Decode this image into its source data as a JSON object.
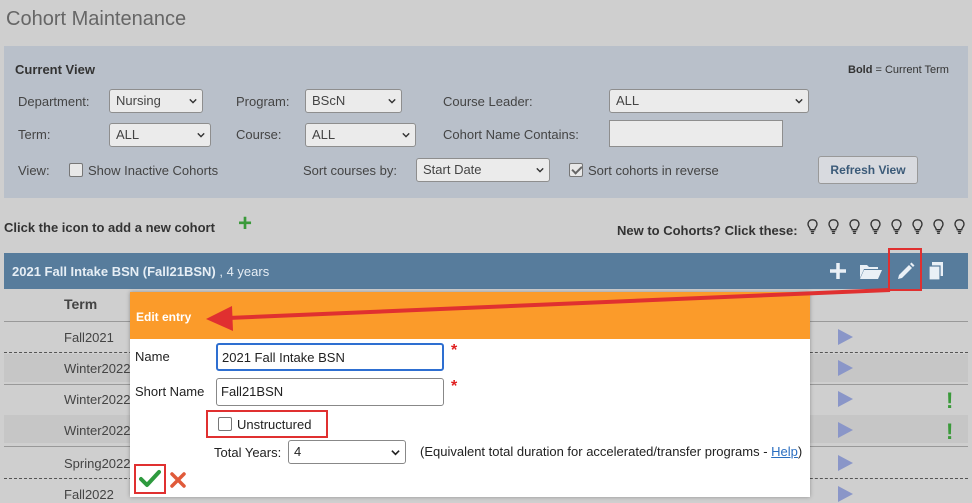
{
  "page": {
    "title": "Cohort Maintenance"
  },
  "current_view": {
    "title": "Current View",
    "bold_note_bold": "Bold",
    "bold_note_rest": " = Current Term",
    "department_label": "Department:",
    "department_value": "Nursing",
    "program_label": "Program:",
    "program_value": "BScN",
    "course_leader_label": "Course Leader:",
    "course_leader_value": "ALL",
    "term_label": "Term:",
    "term_value": "ALL",
    "course_label": "Course:",
    "course_value": "ALL",
    "cohort_name_label": "Cohort Name Contains:",
    "cohort_name_value": "",
    "view_label": "View:",
    "show_inactive_label": "Show Inactive Cohorts",
    "sort_courses_label": "Sort courses by:",
    "sort_courses_value": "Start Date",
    "sort_reverse_label": "Sort cohorts in reverse",
    "refresh_label": "Refresh View"
  },
  "toolbar": {
    "add_text": "Click the icon to add a new cohort",
    "add_icon": "+",
    "new_to_cohorts": "New to Cohorts? Click these:"
  },
  "cohort": {
    "title_bold": "2021 Fall Intake BSN (Fall21BSN)",
    "title_rest": " , 4 years",
    "term_header": "Term",
    "terms": [
      "Fall2021",
      "Winter2022",
      "Winter2022",
      "Winter2022",
      "Spring2022",
      "Fall2022"
    ]
  },
  "dialog": {
    "title": "Edit entry",
    "name_label": "Name",
    "name_value": "2021 Fall Intake BSN",
    "short_name_label": "Short Name",
    "short_name_value": "Fall21BSN",
    "required_mark": "*",
    "unstructured_label": "Unstructured",
    "total_years_label": "Total Years:",
    "total_years_value": "4",
    "equiv_text": "(Equivalent total duration for accelerated/transfer programs - ",
    "help_label": "Help",
    "equiv_close": ")"
  },
  "colors": {
    "accent_orange": "#fb9b2a",
    "cohort_bar": "#577c9c",
    "highlight_red": "#e03030",
    "success_green": "#3a9a3a"
  }
}
